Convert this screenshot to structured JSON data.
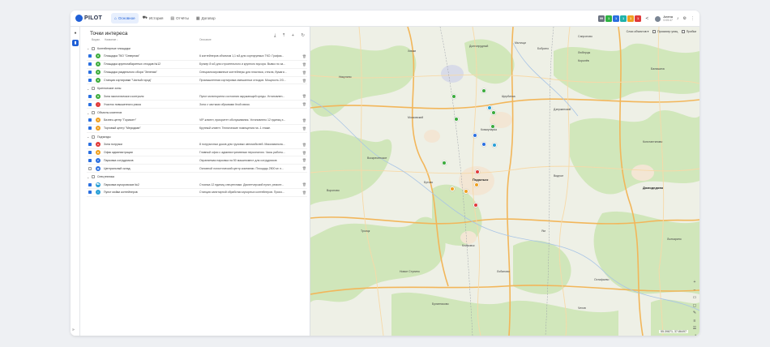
{
  "app": {
    "logo_text": "PILOT",
    "nav": [
      {
        "label": "Основное",
        "icon": "home-icon",
        "glyph": "⌂"
      },
      {
        "label": "История",
        "icon": "truck-icon",
        "glyph": "⛟"
      },
      {
        "label": "Отчёты",
        "icon": "document-icon",
        "glyph": "▤"
      },
      {
        "label": "Договор",
        "icon": "contract-icon",
        "glyph": "▦"
      }
    ],
    "badges": [
      {
        "label": "99",
        "color": "#6b7280"
      },
      {
        "label": "1",
        "color": "#2fb344"
      },
      {
        "label": "1",
        "color": "#2a6fe0"
      },
      {
        "label": "1",
        "color": "#20b2aa"
      },
      {
        "label": "1",
        "color": "#f0a020"
      },
      {
        "label": "1",
        "color": "#e03a3a"
      }
    ],
    "user": {
      "name": "Алена",
      "time": "0:05:47"
    }
  },
  "panel": {
    "title": "Точки интереса",
    "columns": {
      "visible": "Видим.",
      "name": "Название ↓",
      "description": "Описание"
    }
  },
  "groups": [
    {
      "label": "Контейнерные площадки",
      "items": [
        {
          "name": "Площадка ТКО \"Северная\"",
          "desc": "6 контейнеров объемом 1,1 м3 для сортируемых ТКО. График...",
          "color": "#3cab3c",
          "glyph": "♻"
        },
        {
          "name": "Площадка крупногабаритных отходов №12",
          "desc": "Бункер 8 м3 для строительного и крупного мусора. Вывоз по за...",
          "color": "#3cab3c",
          "glyph": "♻"
        },
        {
          "name": "Площадка раздельного сбора \"Зеленая\"",
          "desc": "Специализированные контейнеры для пластика, стекла, бумаги...",
          "color": "#3cab3c",
          "glyph": "♻"
        },
        {
          "name": "Станция сортировки \"Чистый город\"",
          "desc": "Промышленная сортировка смешанных отходов. Мощность 2/3...",
          "color": "#3cab3c",
          "glyph": "♻"
        }
      ]
    },
    {
      "label": "Критические зоны",
      "items": [
        {
          "name": "Зона экологического контроля",
          "desc": "Пункт мониторинга состояния окружающей среды. Установлен...",
          "color": "#3cab3c",
          "glyph": "✚"
        },
        {
          "name": "Участок повышенного риска",
          "desc": "Зона с частыми обрывами linой связи.",
          "color": "#e03a3a",
          "glyph": "!"
        }
      ]
    },
    {
      "label": "Объекты клиентов",
      "items": [
        {
          "name": "Бизнес-центр \"Горизонт\"",
          "desc": "VIP-клиент, приоритет обслуживания. Установлено 12 единиц э...",
          "color": "#f0a020",
          "glyph": "★"
        },
        {
          "name": "Торговый центр \"Меридиан\"",
          "desc": "Крупный клиент. Технические помещения на -1 этаже.",
          "color": "#f0a020",
          "glyph": "★"
        }
      ]
    },
    {
      "label": "Подъезды",
      "items": [
        {
          "name": "Зона погрузки",
          "desc": "8 погрузочных доков для грузовых автомобилей. Максимальна...",
          "color": "#e03a3a",
          "glyph": "▲"
        },
        {
          "name": "Офис администрации",
          "desc": "Главный офис с административным персоналом. Часы работы...",
          "color": "#f0a020",
          "glyph": "■"
        },
        {
          "name": "Парковка сотрудников",
          "desc": "Охраняемая парковка на 50 машиномест для сотрудников",
          "color": "#2a6fe0",
          "glyph": "P"
        },
        {
          "name": "Центральный склад",
          "desc": "Основной логистический центр компании. Площадь 2500 м² л...",
          "color": "#2a6fe0",
          "glyph": "▣",
          "off": true
        }
      ]
    },
    {
      "label": "Спецтехника",
      "items": [
        {
          "name": "Парковка мусоровозов №2",
          "desc": "Стоянка 12 единиц спецтехники. Диспетчерский пункт, ремонт...",
          "color": "#2a9fd6",
          "glyph": "⛟"
        },
        {
          "name": "Пункт мойки контейнеров",
          "desc": "Станция санитарной обработки мусорных контейнеров. Произ...",
          "color": "#2a9fd6",
          "glyph": "≈"
        }
      ]
    }
  ],
  "map": {
    "layers_label": "Слои объектов",
    "traffic_label": "Просмотр улиц",
    "jams_label": "Пробки",
    "coordinates": "55.39871, 37.86497",
    "towns": [
      "Долгопрудный",
      "Мытищи",
      "Химки",
      "Балашиха",
      "Королёв",
      "Щербинка",
      "Подольск",
      "Домодедово",
      "Климовск",
      "Видное",
      "Московский",
      "Троицк",
      "Лыткарино",
      "Чехов",
      "Дзержинский",
      "Люберцы",
      "Бутово",
      "Коммунарка",
      "Воскресенское",
      "Остафьево",
      "Бобрино",
      "Сапроново",
      "Константиново",
      "Ям",
      "Новое Ступино",
      "Лобаново",
      "Булатниково",
      "Никулино",
      "Вороново"
    ],
    "poi_colors": [
      "#3cab3c",
      "#3cab3c",
      "#3cab3c",
      "#3cab3c",
      "#3cab3c",
      "#3cab3c",
      "#e03a3a",
      "#f0a020",
      "#f0a020",
      "#e03a3a",
      "#f0a020",
      "#2a6fe0",
      "#2a6fe0",
      "#2a9fd6",
      "#2a9fd6"
    ]
  }
}
